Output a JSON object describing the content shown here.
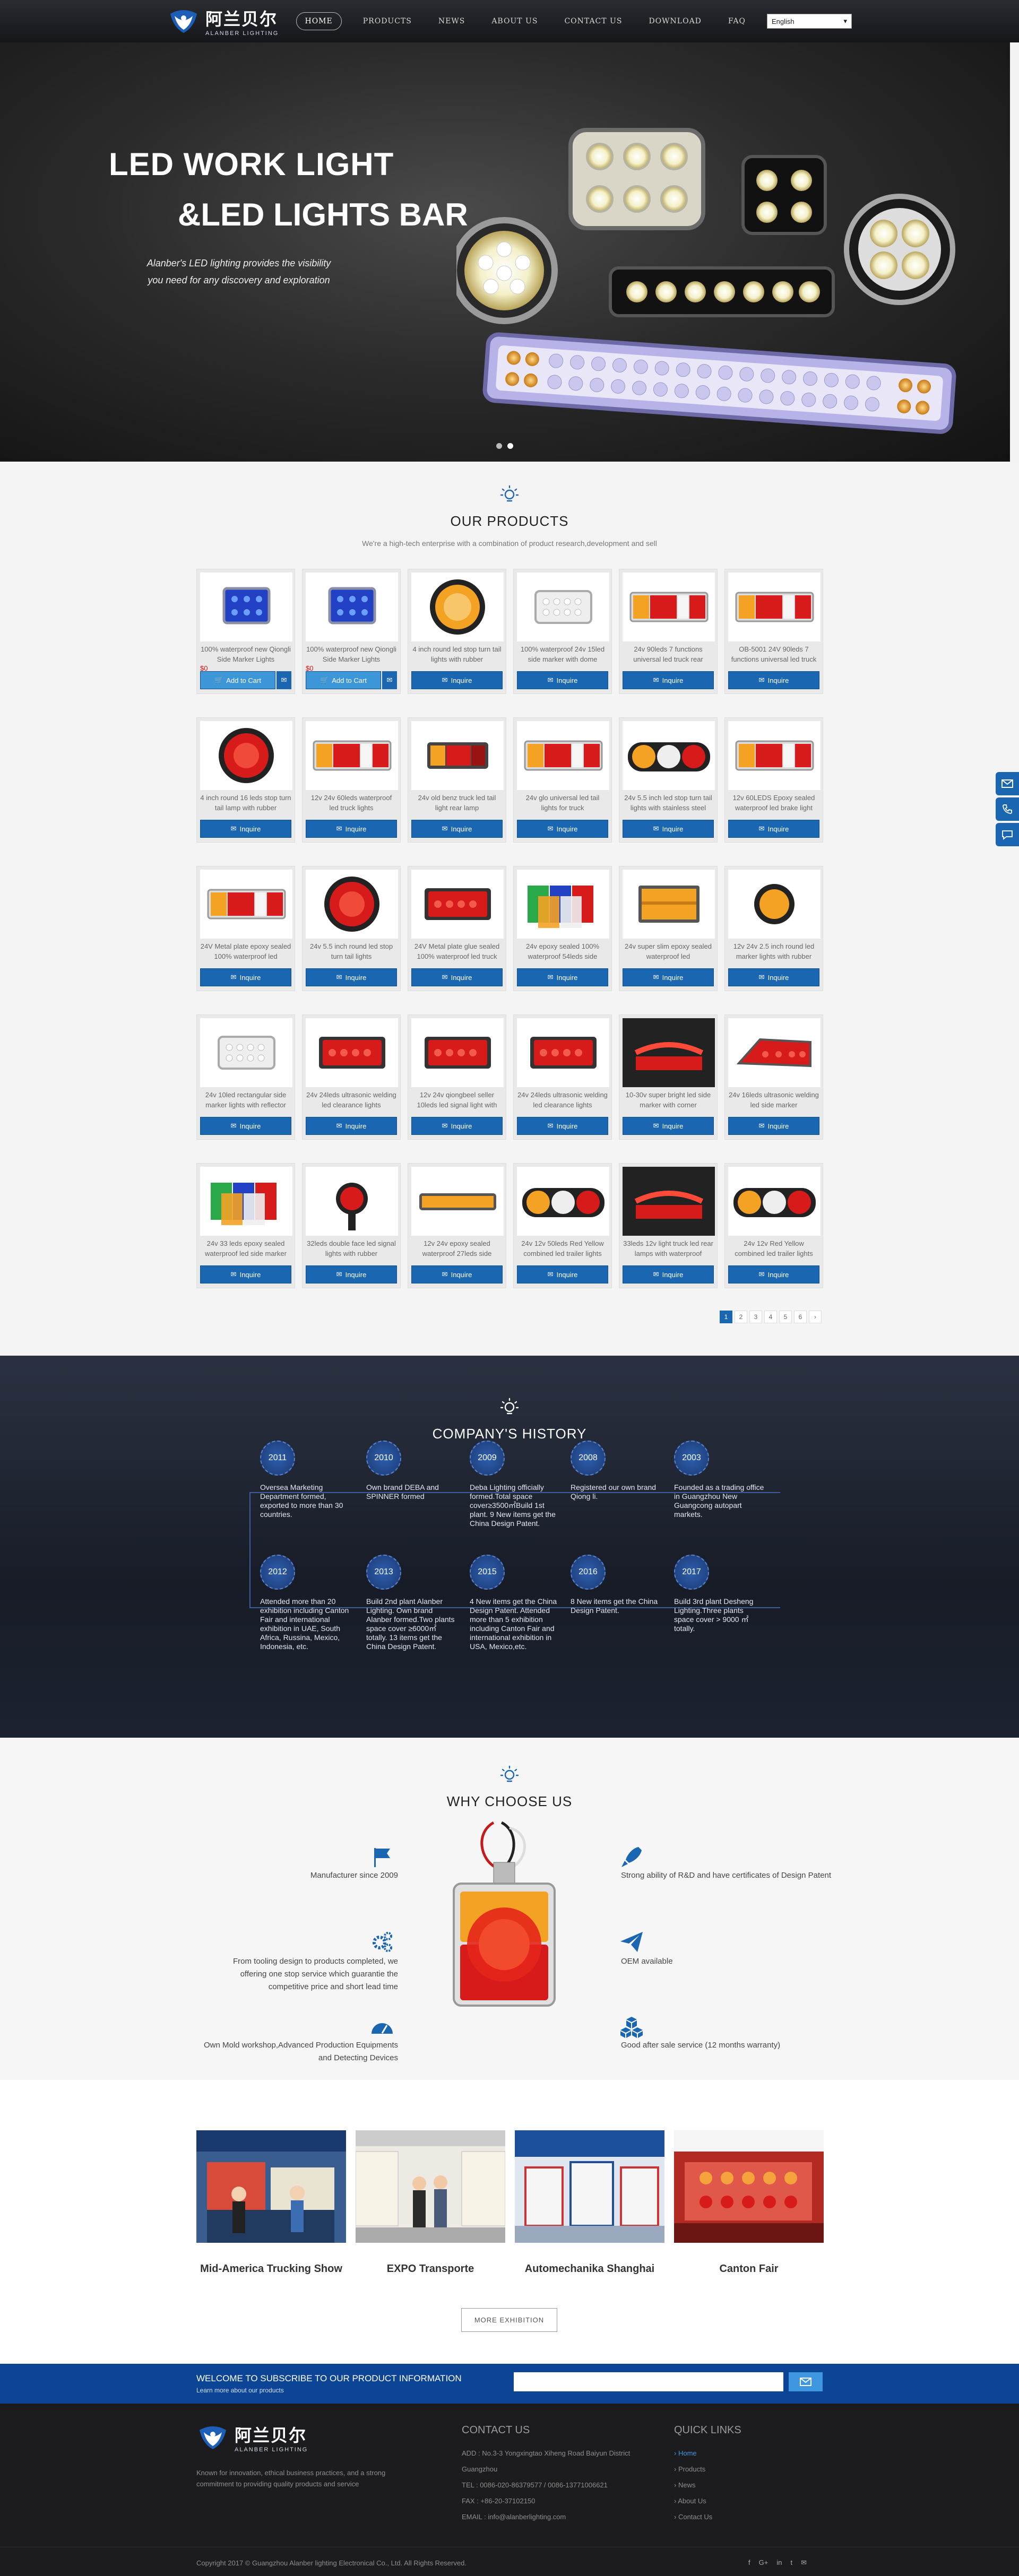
{
  "header": {
    "logo_cn": "阿兰贝尔",
    "logo_en": "ALANBER LIGHTING",
    "nav": [
      "HOME",
      "PRODUCTS",
      "NEWS",
      "ABOUT US",
      "CONTACT US",
      "DOWNLOAD",
      "FAQ"
    ],
    "language": "English"
  },
  "banner": {
    "title1": "LED WORK LIGHT",
    "title2": "&LED LIGHTS BAR",
    "subtitle1": "Alanber's LED lighting provides the visibility",
    "subtitle2": "you need for any discovery and exploration"
  },
  "products": {
    "title": "OUR PRODUCTS",
    "subtitle": "We're a high-tech enterprise with a combination of product research,development and sell",
    "add_to_cart": "Add to Cart",
    "inquire": "Inquire",
    "items": [
      {
        "name": "100% waterproof new Qiongli Side Marker Lights",
        "price": "$0",
        "img": "blue-marker",
        "cart": true
      },
      {
        "name": "100% waterproof new Qiongli Side Marker Lights",
        "price": "$0",
        "img": "blue-marker",
        "cart": true
      },
      {
        "name": "4 inch round led stop turn tail lights with rubber",
        "price": "",
        "img": "amber-round"
      },
      {
        "name": "100% waterproof 24v 15led side marker with dome",
        "price": "",
        "img": "clear-marker"
      },
      {
        "name": "24v 90leds 7 functions universal led truck rear",
        "price": "",
        "img": "tail-combo"
      },
      {
        "name": "OB-5001 24V 90leds 7 functions universal led truck",
        "price": "",
        "img": "tail-combo"
      },
      {
        "name": "4 inch round 16 leds stop turn tail lamp with rubber",
        "price": "",
        "img": "red-round"
      },
      {
        "name": "12v 24v 60leds waterproof led truck lights",
        "price": "",
        "img": "tail-combo"
      },
      {
        "name": "24v old benz truck led tail light rear lamp",
        "price": "",
        "img": "benz"
      },
      {
        "name": "24v glo universal led tail lights for truck",
        "price": "",
        "img": "tail-combo"
      },
      {
        "name": "24v 5.5 inch led stop turn tail lights with stainless steel",
        "price": "",
        "img": "triple-round"
      },
      {
        "name": "12v 60LEDS Epoxy sealed waterproof led brake light",
        "price": "",
        "img": "tail-combo"
      },
      {
        "name": "24V Metal plate epoxy sealed 100% waterproof led",
        "price": "",
        "img": "tail-combo"
      },
      {
        "name": "24v 5.5 inch round led stop turn tail lights",
        "price": "",
        "img": "red-round"
      },
      {
        "name": "24V Metal plate glue sealed 100% waterproof led truck",
        "price": "",
        "img": "red-rect"
      },
      {
        "name": "24v epoxy sealed 100% waterproof 54leds side",
        "price": "",
        "img": "multi-color"
      },
      {
        "name": "24v super slim epoxy sealed waterproof led",
        "price": "",
        "img": "amber-rect"
      },
      {
        "name": "12v 24v 2.5 inch round led marker lights with rubber",
        "price": "",
        "img": "amber-small"
      },
      {
        "name": "24v 10led rectangular side marker lights with reflector",
        "price": "",
        "img": "clear-marker"
      },
      {
        "name": "24v 24leds ultrasonic welding led clearance lights",
        "price": "",
        "img": "red-rect"
      },
      {
        "name": "12v 24v qiongbeel seller 10leds led signal light with",
        "price": "",
        "img": "red-rect"
      },
      {
        "name": "24v 24leds ultrasonic welding led clearance lights",
        "price": "",
        "img": "red-rect"
      },
      {
        "name": "10-30v super bright led side marker with corner",
        "price": "",
        "img": "neon"
      },
      {
        "name": "24v 16leds ultrasonic welding led side marker",
        "price": "",
        "img": "red-wedge"
      },
      {
        "name": "24v 33 leds epoxy sealed waterproof led side marker",
        "price": "",
        "img": "multi-color"
      },
      {
        "name": "32leds double face led signal lights with rubber",
        "price": "",
        "img": "stalk"
      },
      {
        "name": "12v 24v epoxy sealed waterproof 27leds side",
        "price": "",
        "img": "amber-strip"
      },
      {
        "name": "24v 12v 50leds Red Yellow combined led trailer lights",
        "price": "",
        "img": "triple-round"
      },
      {
        "name": "33leds 12v light truck led rear lamps with waterproof",
        "price": "",
        "img": "neon"
      },
      {
        "name": "24v 12v Red Yellow combined led trailer lights",
        "price": "",
        "img": "triple-round"
      }
    ],
    "pages": [
      "1",
      "2",
      "3",
      "4",
      "5",
      "6",
      "›"
    ]
  },
  "history": {
    "title": "COMPANY'S HISTORY",
    "row1": [
      {
        "year": "2011",
        "text": "Oversea Marketing Department formed, exported to more than 30 countries."
      },
      {
        "year": "2010",
        "text": "Own brand DEBA and SPINNER formed"
      },
      {
        "year": "2009",
        "text": "Deba Lighting officially formed.Total space cover≥3500㎡Build 1st plant. 9 New items get the China Design Patent."
      },
      {
        "year": "2008",
        "text": "Registered our own brand Qiong li."
      },
      {
        "year": "2003",
        "text": "Founded as a trading office in Guangzhou New Guangcong autopart markets."
      }
    ],
    "row2": [
      {
        "year": "2012",
        "text": "Attended more than 20 exhibition including Canton Fair and international exhibition in UAE, South Africa, Russina, Mexico, Indonesia, etc."
      },
      {
        "year": "2013",
        "text": "Build 2nd plant Alanber Lighting. Own brand Alanber formed.Two plants space cover ≥6000㎡ totally. 13 items get the China Design Patent."
      },
      {
        "year": "2015",
        "text": "4 New items get the China Design Patent. Attended more than 5 exhibition including Canton Fair and international exhibition in USA, Mexico,etc."
      },
      {
        "year": "2016",
        "text": "8 New items get the China Design Patent."
      },
      {
        "year": "2017",
        "text": "Build 3rd plant Desheng Lighting.Three plants space cover > 9000 ㎡ totally."
      }
    ]
  },
  "why": {
    "title": "WHY CHOOSE US",
    "left": [
      "Manufacturer since 2009",
      "From tooling design to products completed, we offering one stop service which guarantie the competitive price and short lead time",
      "Own Mold workshop,Advanced Production Equipments and Detecting Devices"
    ],
    "right": [
      "Strong ability of R&D and have certificates of Design Patent",
      "OEM available",
      "Good after sale service (12 months warranty)"
    ]
  },
  "expo": {
    "items": [
      "Mid-America Trucking Show",
      "EXPO Transporte",
      "Automechanika Shanghai",
      "Canton Fair"
    ],
    "more": "MORE EXHIBITION"
  },
  "subscribe": {
    "title": "WELCOME TO SUBSCRIBE TO OUR PRODUCT INFORMATION",
    "subtitle": "Learn more about our products"
  },
  "footer": {
    "about": "Known for innovation, ethical business practices, and a strong commitment to providing quality products and service",
    "contact_title": "CONTACT US",
    "contact": [
      "ADD : No.3-3 Yongxingtao Xiheng Road Baiyun District Guangzhou",
      "TEL : 0086-020-86379577 / 0086-13771006621",
      "FAX : +86-20-37102150",
      "EMAIL : info@alanberlighting.com"
    ],
    "links_title": "QUICK LINKS",
    "links": [
      "Home",
      "Products",
      "News",
      "About Us",
      "Contact Us"
    ],
    "copyright": "Copyright 2017 © Guangzhou Alanber lighting Electronical Co., Ltd.  All Rights Reserved.",
    "social": [
      "f",
      "G+",
      "in",
      "t",
      "✉"
    ]
  }
}
